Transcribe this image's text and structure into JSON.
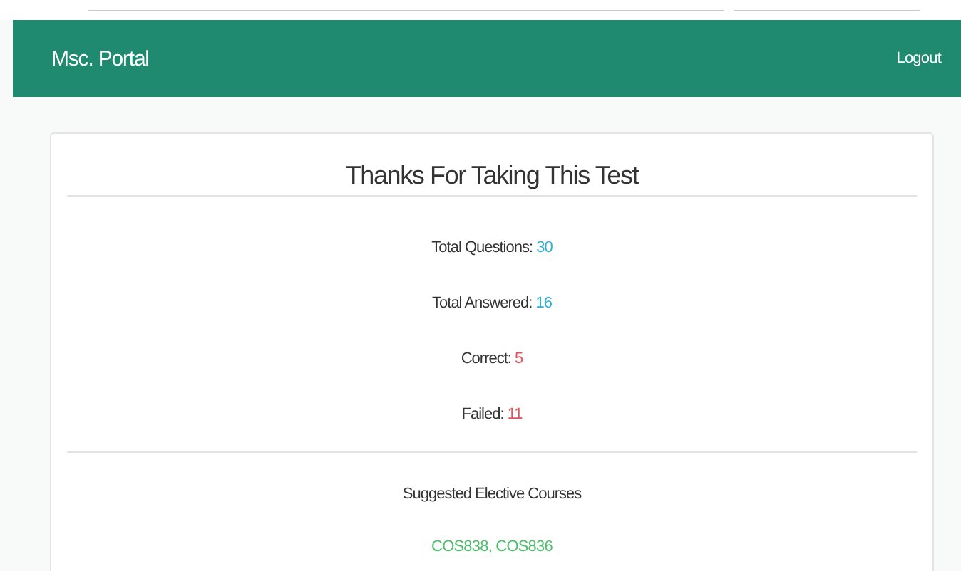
{
  "navbar": {
    "brand": "Msc. Portal",
    "logout": "Logout"
  },
  "result": {
    "title": "Thanks For Taking This Test",
    "stats": [
      {
        "label": "Total Questions:",
        "value": "30",
        "color": "#31b0d5"
      },
      {
        "label": "Total Answered:",
        "value": "16",
        "color": "#31b0d5"
      },
      {
        "label": "Correct:",
        "value": "5",
        "color": "#e8505b"
      },
      {
        "label": "Failed:",
        "value": "11",
        "color": "#e8505b"
      }
    ],
    "suggestion_heading": "Suggested Elective Courses",
    "courses": "COS838, COS836"
  }
}
